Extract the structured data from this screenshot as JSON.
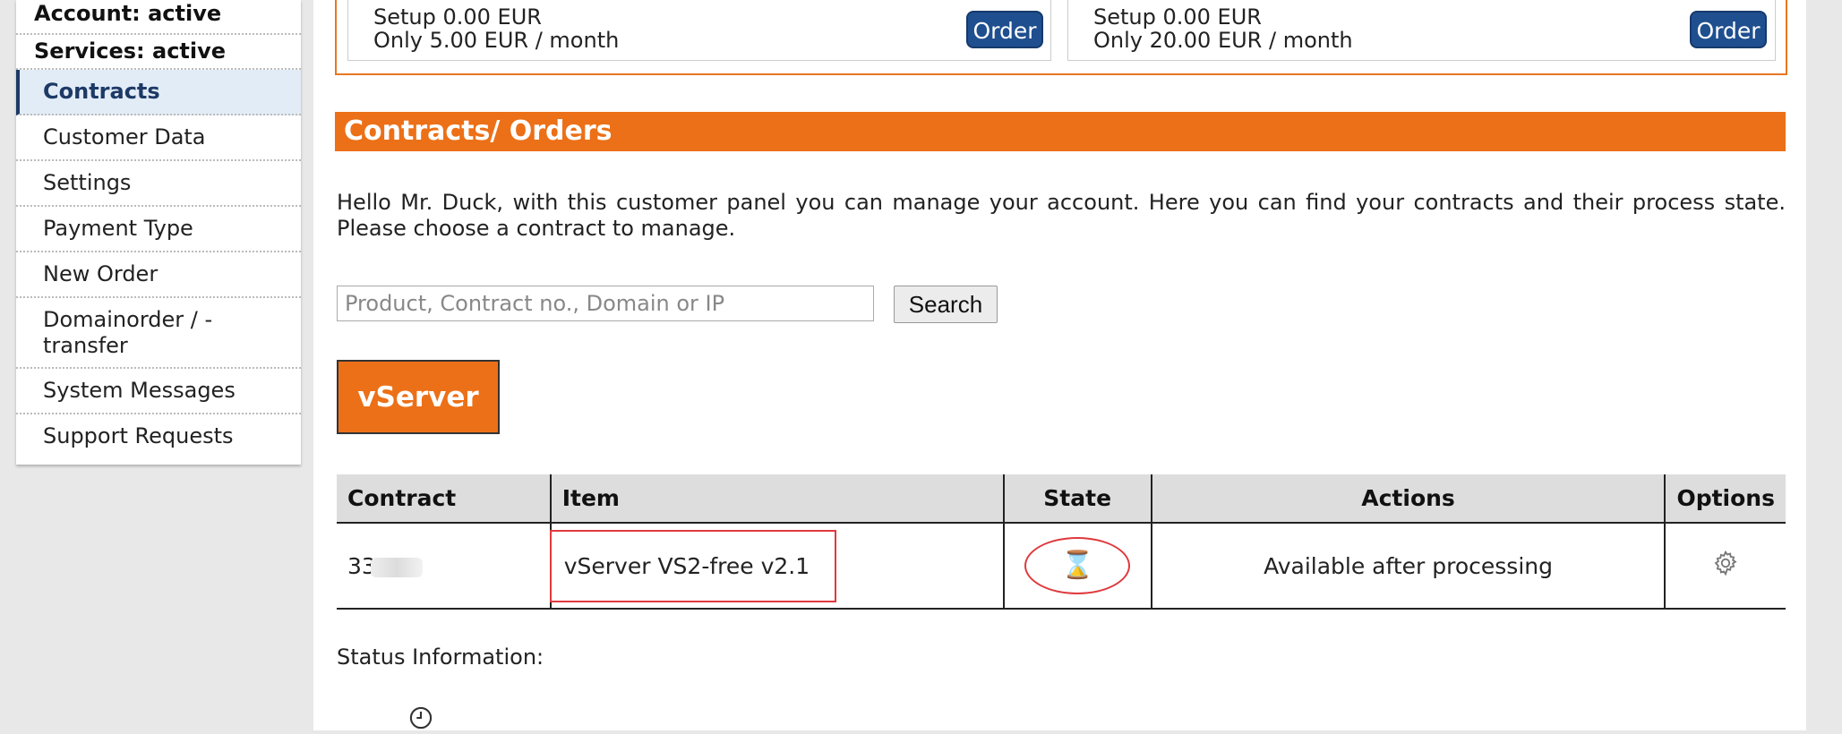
{
  "sidebar": {
    "statuses": [
      "Account: active",
      "Services: active"
    ],
    "items": [
      {
        "label": "Contracts",
        "active": true
      },
      {
        "label": "Customer Data"
      },
      {
        "label": "Settings"
      },
      {
        "label": "Payment Type"
      },
      {
        "label": "New Order"
      },
      {
        "label": "Domainorder / -\ntransfer"
      },
      {
        "label": "System Messages"
      },
      {
        "label": "Support Requests"
      }
    ]
  },
  "offers": [
    {
      "setup": "Setup 0.00 EUR",
      "monthly": "Only 5.00 EUR / month",
      "button": "Order"
    },
    {
      "setup": "Setup 0.00 EUR",
      "monthly": "Only 20.00 EUR / month",
      "button": "Order"
    }
  ],
  "section_title": "Contracts/ Orders",
  "intro_text": "Hello Mr. Duck, with this customer panel you can manage your account. Here you can find your contracts and their process state. Please choose a contract to manage.",
  "search": {
    "placeholder": "Product, Contract no., Domain or IP",
    "button": "Search"
  },
  "category_tab": "vServer",
  "table": {
    "headers": [
      "Contract",
      "Item",
      "State",
      "Actions",
      "Options"
    ],
    "rows": [
      {
        "contract": "33",
        "item": "vServer VS2-free v2.1",
        "state_icon": "hourglass-icon",
        "action": "Available after processing",
        "options_icon": "gear-icon"
      }
    ]
  },
  "status_label": "Status Information:",
  "colors": {
    "accent_orange": "#ec7017",
    "order_button": "#1f4f8f",
    "highlight_red": "#e0393e"
  }
}
